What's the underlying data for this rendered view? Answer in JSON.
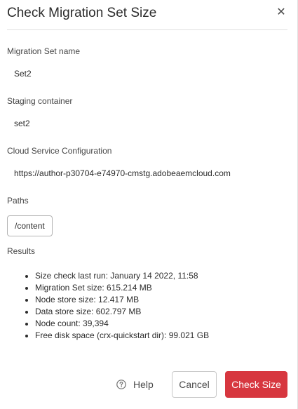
{
  "dialog": {
    "title": "Check Migration Set Size",
    "close_icon": "close-icon"
  },
  "fields": {
    "migration_set_name": {
      "label": "Migration Set name",
      "value": "Set2"
    },
    "staging_container": {
      "label": "Staging container",
      "value": "set2"
    },
    "cloud_service_configuration": {
      "label": "Cloud Service Configuration",
      "value": "https://author-p30704-e74970-cmstg.adobeaemcloud.com"
    },
    "paths": {
      "label": "Paths",
      "items": [
        "/content"
      ]
    }
  },
  "results": {
    "label": "Results",
    "items": [
      "Size check last run: January 14 2022, 11:58",
      "Migration Set size: 615.214 MB",
      "Node store size: 12.417 MB",
      "Data store size: 602.797 MB",
      "Node count: 39,394",
      "Free disk space (crx-quickstart dir): 99.021 GB"
    ]
  },
  "footer": {
    "help_label": "Help",
    "help_icon": "help-circle-icon",
    "cancel_label": "Cancel",
    "check_size_label": "Check Size"
  },
  "colors": {
    "primary_button": "#d7373f",
    "divider": "#e1e1e1",
    "text": "#2c2c2c"
  }
}
